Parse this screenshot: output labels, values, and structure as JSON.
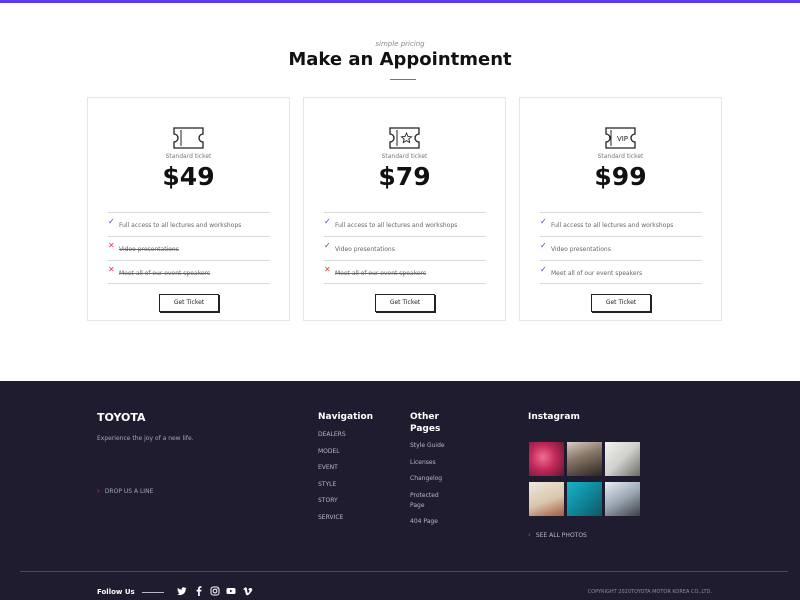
{
  "pricing": {
    "subtitle": "simple pricing",
    "title": "Make an Appointment",
    "plans": [
      {
        "label": "Standard ticket",
        "price": "$49",
        "icon": "ticket-icon",
        "features": [
          {
            "text": "Full access to all lectures and workshops",
            "included": true
          },
          {
            "text": "Video presentations",
            "included": false
          },
          {
            "text": "Meet all of our event speakers",
            "included": false
          }
        ],
        "button": "Get Ticket"
      },
      {
        "label": "Standard ticket",
        "price": "$79",
        "icon": "ticket-star-icon",
        "features": [
          {
            "text": "Full access to all lectures and workshops",
            "included": true
          },
          {
            "text": "Video presentations",
            "included": true
          },
          {
            "text": "Meet all of our event speakers",
            "included": false
          }
        ],
        "button": "Get Ticket"
      },
      {
        "label": "Standard ticket",
        "price": "$99",
        "icon": "ticket-vip-icon",
        "icon_text": "VIP",
        "features": [
          {
            "text": "Full access to all lectures and workshops",
            "included": true
          },
          {
            "text": "Video presentations",
            "included": true
          },
          {
            "text": "Meet all of our event speakers",
            "included": true
          }
        ],
        "button": "Get Ticket"
      }
    ]
  },
  "footer": {
    "brand": "TOYOTA",
    "tagline": "Experience the joy of a new life.",
    "drop_line": "DROP US A LINE",
    "navigation": {
      "heading": "Navigation",
      "links": [
        "DEALERS",
        "MODEL",
        "EVENT",
        "STYLE",
        "STORY",
        "SERVICE"
      ]
    },
    "other_pages": {
      "heading_line1": "Other",
      "heading_line2": "Pages",
      "links": [
        "Style Guide",
        "Licenses",
        "Changelog",
        "Protected",
        "Page",
        "404 Page"
      ]
    },
    "instagram": {
      "heading": "Instagram",
      "see_all": "SEE ALL PHOTOS"
    },
    "follow_us": "Follow Us",
    "social_icons": [
      "twitter-icon",
      "facebook-icon",
      "instagram-icon",
      "youtube-icon",
      "vimeo-icon"
    ],
    "copyright": "COPYRIGHT 2020TOYOTA MOTOR KOREA CO.,LTD."
  },
  "colors": {
    "accent": "#e8434b",
    "top_bar": "#5b3cf0",
    "footer_bg": "#1e1c2e",
    "check": "#3b3bbf"
  }
}
